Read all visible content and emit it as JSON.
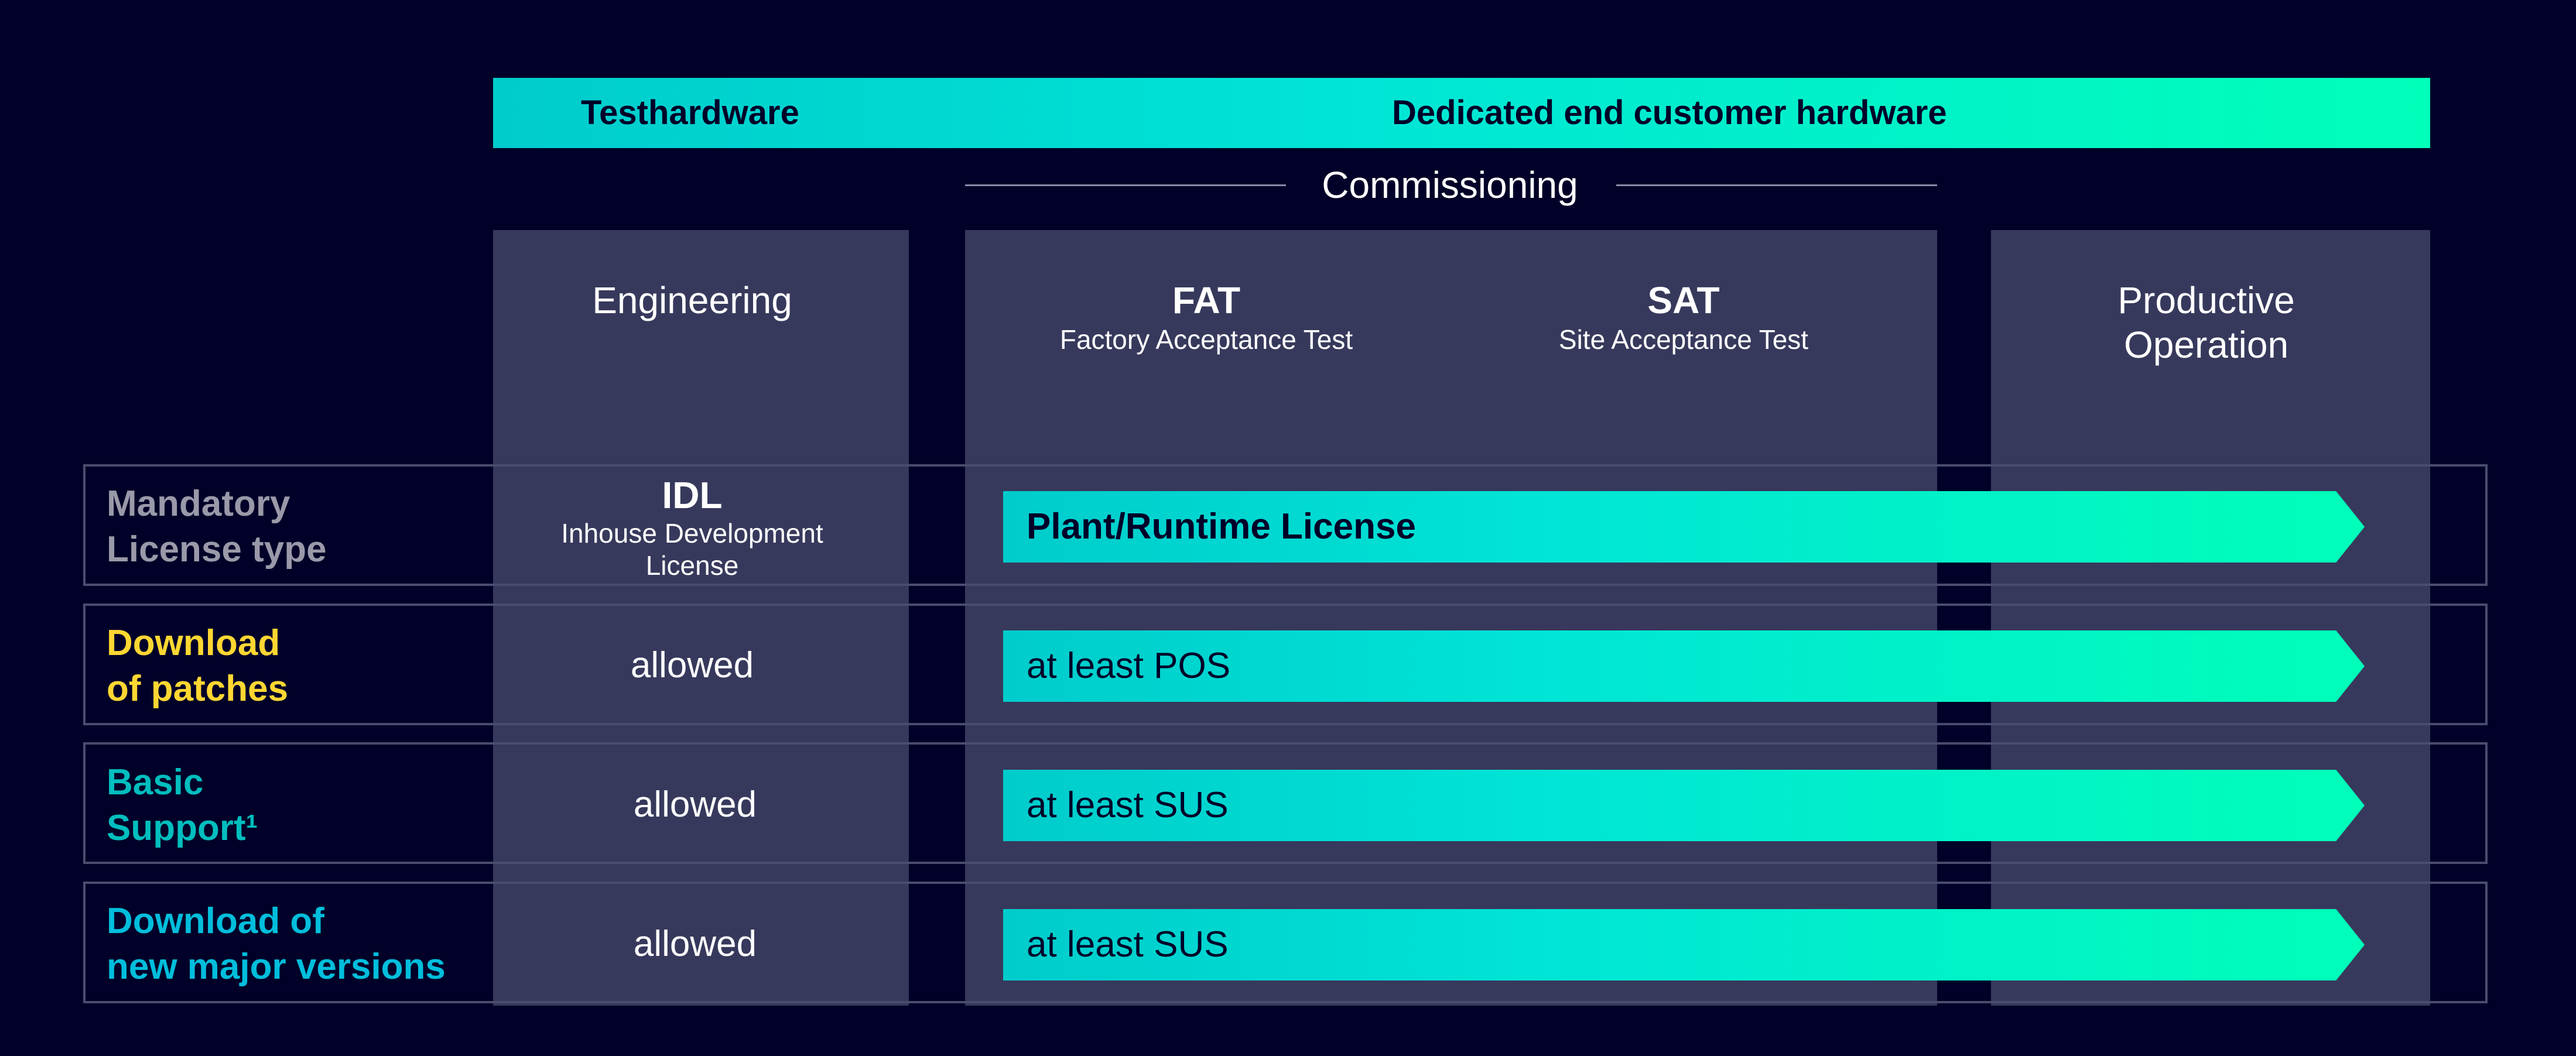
{
  "hardware": {
    "test_label": "Testhardware",
    "dedicated_label": "Dedicated end customer hardware"
  },
  "commissioning": {
    "label": "Commissioning"
  },
  "phases": {
    "engineering": {
      "title": "Engineering"
    },
    "fat": {
      "title": "FAT",
      "subtitle": "Factory Acceptance Test"
    },
    "sat": {
      "title": "SAT",
      "subtitle": "Site Acceptance Test"
    },
    "productive": {
      "title_line1": "Productive",
      "title_line2": "Operation"
    }
  },
  "rows": [
    {
      "label_line1": "Mandatory",
      "label_line2": "License type",
      "color": "#9999a9",
      "engineering_title": "IDL",
      "engineering_sub_line1": "Inhouse Development",
      "engineering_sub_line2": "License",
      "arrow_text": "Plant/Runtime License"
    },
    {
      "label_line1": "Download",
      "label_line2": "of patches",
      "color": "#ffd732",
      "engineering_value": "allowed",
      "arrow_text": "at least POS"
    },
    {
      "label_line1": "Basic",
      "label_line2": "Support¹",
      "color": "#00bebe",
      "engineering_value": "allowed",
      "arrow_text": "at least SUS"
    },
    {
      "label_line1": "Download of",
      "label_line2": "new major versions",
      "color": "#00bedc",
      "engineering_value": "allowed",
      "arrow_text": "at least SUS"
    }
  ],
  "colors": {
    "background": "#000028",
    "column": "#37395c",
    "accent_start": "#00cccc",
    "accent_end": "#00ffb9"
  }
}
